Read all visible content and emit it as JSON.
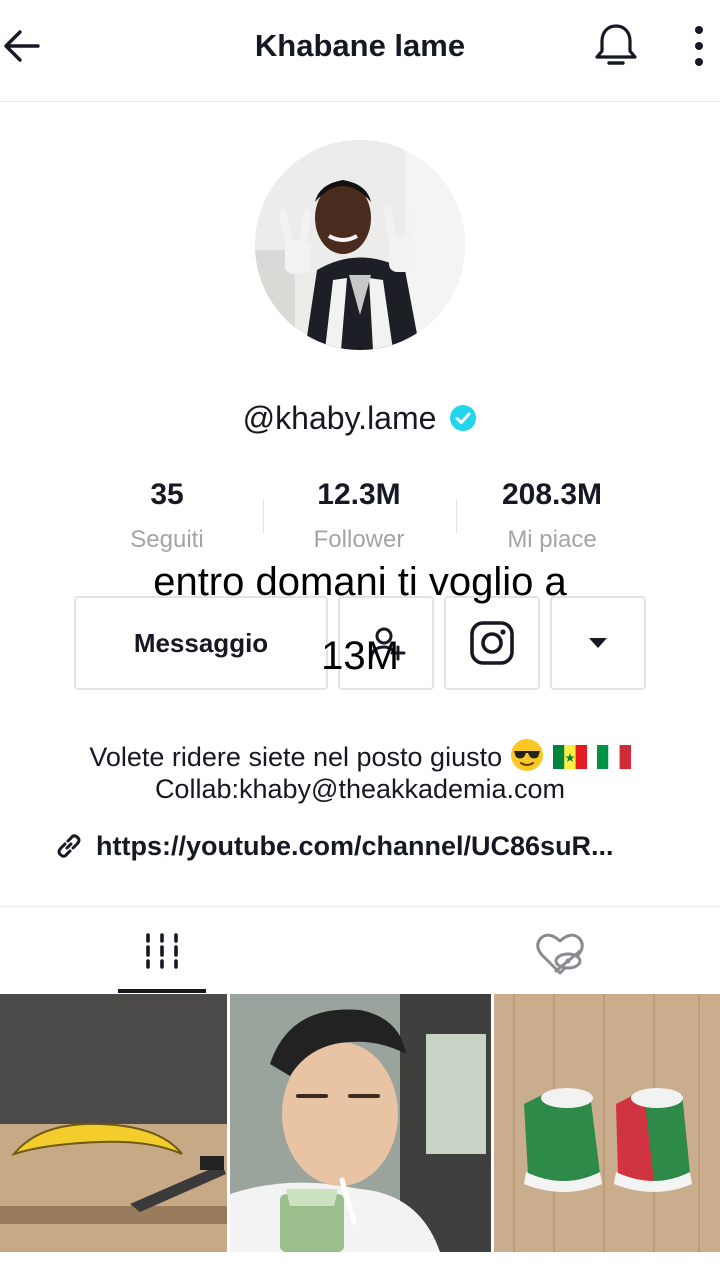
{
  "header": {
    "title": "Khabane lame",
    "back_icon": "arrow-left-icon",
    "bell_icon": "bell-icon",
    "more_icon": "more-vertical-icon"
  },
  "profile": {
    "handle": "@khaby.lame",
    "verified_icon": "verified-badge-icon",
    "verified_color": "#20d5ec",
    "stats": [
      {
        "value": "35",
        "label": "Seguiti"
      },
      {
        "value": "12.3M",
        "label": "Follower"
      },
      {
        "value": "208.3M",
        "label": "Mi piace"
      }
    ],
    "message_button": "Messaggio",
    "add_friend_icon": "add-friend-icon",
    "instagram_icon": "instagram-icon",
    "dropdown_icon": "caret-down-icon"
  },
  "overlay": {
    "line1": "entro domani ti voglio a",
    "line2": "13M"
  },
  "bio": {
    "line1": "Volete ridere siete nel posto giusto",
    "emoji": "sunglasses-emoji",
    "flags": [
      "senegal-flag",
      "italy-flag"
    ],
    "line2": "Collab:khaby@theakkademia.com",
    "link_icon": "link-icon",
    "link": "https://youtube.com/channel/UC86suR..."
  },
  "tabs": {
    "videos_icon": "grid-videos-icon",
    "liked_icon": "hidden-liked-icon"
  },
  "videos": [
    {
      "name": "video-thumb-banana"
    },
    {
      "name": "video-thumb-man-drinking"
    },
    {
      "name": "video-thumb-cups"
    }
  ]
}
